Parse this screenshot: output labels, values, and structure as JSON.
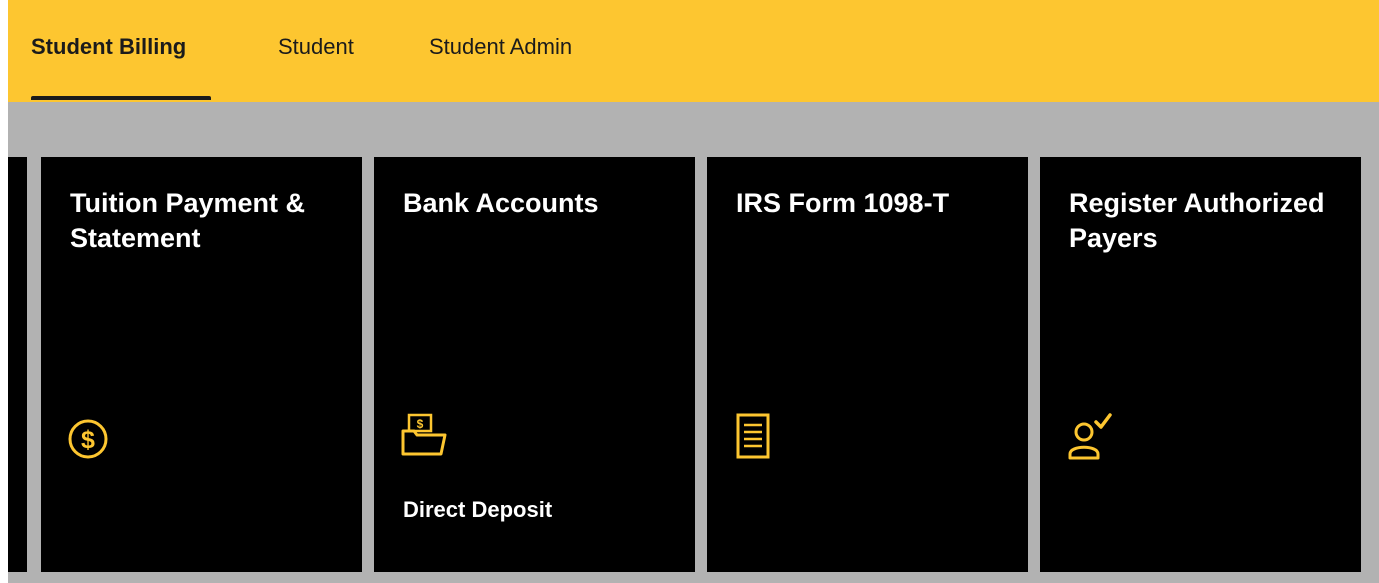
{
  "tabs": [
    {
      "label": "Student Billing",
      "active": true
    },
    {
      "label": "Student",
      "active": false
    },
    {
      "label": "Student Admin",
      "active": false
    }
  ],
  "tiles": [
    {
      "title": "Tuition Payment & Statement",
      "icon": "dollar-circle-icon",
      "subtitle": ""
    },
    {
      "title": "Bank Accounts",
      "icon": "money-folder-icon",
      "subtitle": "Direct Deposit"
    },
    {
      "title": "IRS Form 1098-T",
      "icon": "document-list-icon",
      "subtitle": ""
    },
    {
      "title": "Register Authorized Payers",
      "icon": "user-check-icon",
      "subtitle": ""
    }
  ],
  "colors": {
    "header": "#fdc630",
    "background": "#b2b2b2",
    "tile": "#000000",
    "accent": "#fdc630",
    "tile_text": "#ffffff",
    "tab_text": "#1b1b1b"
  }
}
